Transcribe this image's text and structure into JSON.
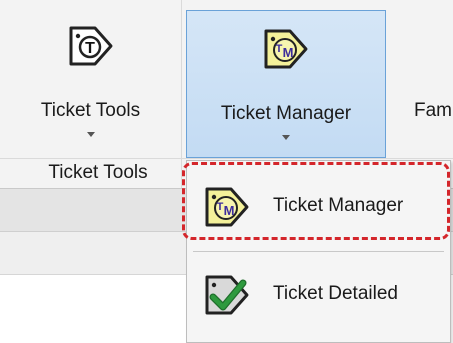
{
  "ribbon": {
    "buttons": [
      {
        "label": "Ticket Tools",
        "icon": "ticket-t-icon"
      },
      {
        "label": "Ticket Manager",
        "icon": "ticket-tm-icon"
      },
      {
        "label": "Fam",
        "icon": ""
      }
    ],
    "group_label": "Ticket Tools"
  },
  "dropdown": {
    "items": [
      {
        "label": "Ticket Manager",
        "icon": "ticket-tm-icon"
      },
      {
        "label": "Ticket Detailed",
        "icon": "ticket-check-icon"
      }
    ]
  },
  "colors": {
    "active_button_bg": "#c8def4",
    "active_button_border": "#6aa2d8",
    "highlight_dash": "#d4262b",
    "tm_tag_fill": "#f4f19a",
    "tm_text": "#3d2c9c",
    "check_green": "#2e9a3e"
  }
}
